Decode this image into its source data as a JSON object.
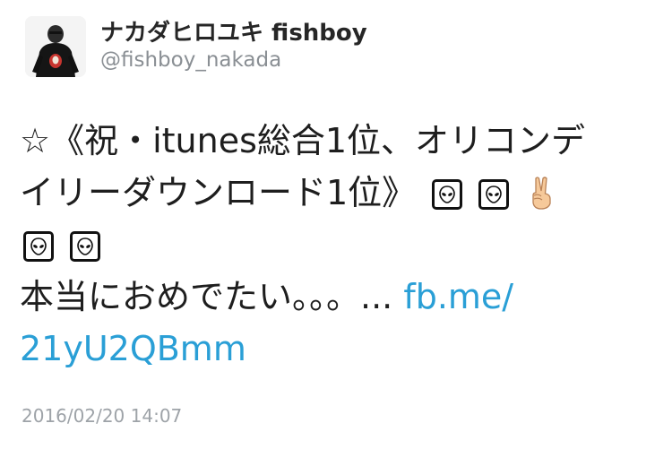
{
  "user": {
    "display_name": "ナカダヒロユキ fishboy",
    "handle": "@fishboy_nakada"
  },
  "tweet": {
    "line1": "☆《祝・itunes総合1位、オリコンデ",
    "line2": "イリーダウンロード1位》",
    "line3_icons": [
      "alien-icon",
      "alien-icon"
    ],
    "line2_icons": [
      "alien-icon",
      "alien-icon",
      "victory-hand-icon"
    ],
    "line4_text": "本当におめでたい。。。... ",
    "link_part1": "fb.me/",
    "link_part2": "21yU2QBmm",
    "timestamp": "2016/02/20 14:07"
  },
  "colors": {
    "link": "#2a9fd6",
    "handle": "#8a8f94",
    "timestamp": "#9ea3a8"
  }
}
